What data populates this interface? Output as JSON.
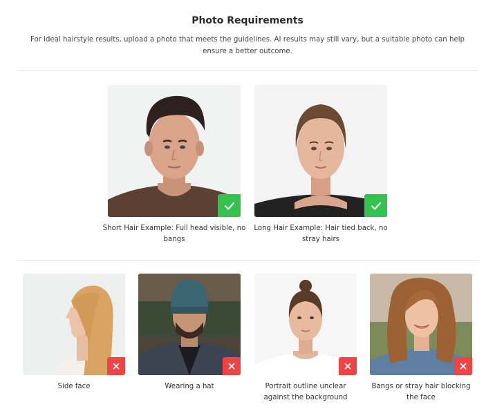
{
  "header": {
    "title": "Photo Requirements",
    "description": "For ideal hairstyle results, upload a photo that meets the guidelines. AI results may still vary, but a suitable photo can help ensure a better outcome."
  },
  "good_examples": [
    {
      "caption": "Short Hair Example: Full head visible, no bangs",
      "status_icon": "check-icon",
      "status_color": "#33c24d"
    },
    {
      "caption": "Long Hair Example: Hair tied back, no stray hairs",
      "status_icon": "check-icon",
      "status_color": "#33c24d"
    }
  ],
  "bad_examples": [
    {
      "caption": "Side face",
      "status_icon": "close-icon",
      "status_color": "#ef4444"
    },
    {
      "caption": "Wearing a hat",
      "status_icon": "close-icon",
      "status_color": "#ef4444"
    },
    {
      "caption": "Portrait outline unclear against the background",
      "status_icon": "close-icon",
      "status_color": "#ef4444"
    },
    {
      "caption": "Bangs or stray hair blocking the face",
      "status_icon": "close-icon",
      "status_color": "#ef4444"
    }
  ]
}
